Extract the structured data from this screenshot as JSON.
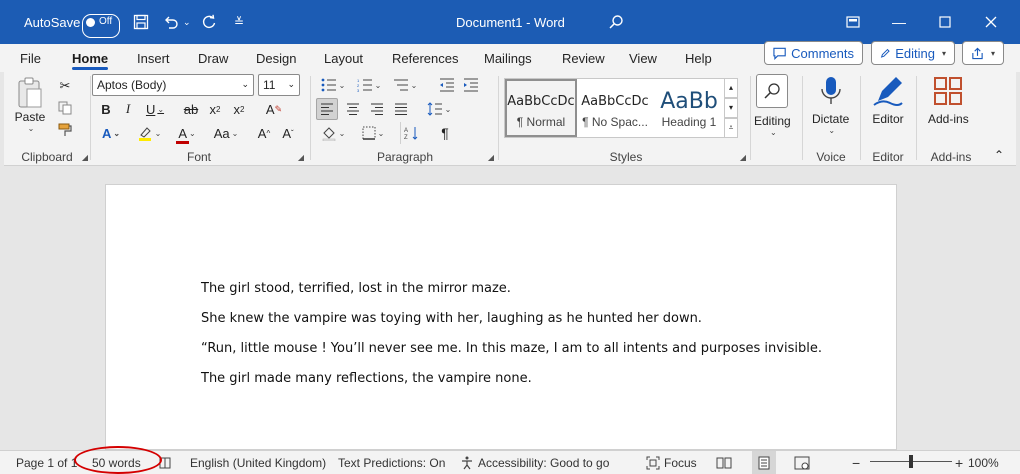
{
  "titlebar": {
    "autosave_label": "AutoSave",
    "autosave_state": "Off",
    "document_title": "Document1  -  Word"
  },
  "tabs": [
    "File",
    "Home",
    "Insert",
    "Draw",
    "Design",
    "Layout",
    "References",
    "Mailings",
    "Review",
    "View",
    "Help"
  ],
  "active_tab": "Home",
  "tab_buttons": {
    "comments": "Comments",
    "editing": "Editing"
  },
  "clipboard": {
    "paste": "Paste",
    "label": "Clipboard"
  },
  "font": {
    "name": "Aptos (Body)",
    "size": "11",
    "label": "Font"
  },
  "paragraph": {
    "label": "Paragraph"
  },
  "styles": {
    "label": "Styles",
    "items": [
      {
        "sample": "AaBbCcDc",
        "name": "¶ Normal"
      },
      {
        "sample": "AaBbCcDc",
        "name": "¶ No Spac..."
      },
      {
        "sample": "AaBb",
        "name": "Heading 1"
      }
    ]
  },
  "editing_group": {
    "label": "Editing"
  },
  "voice": {
    "button": "Dictate",
    "label": "Voice"
  },
  "editor": {
    "button": "Editor",
    "label": "Editor"
  },
  "addins": {
    "button": "Add-ins",
    "label": "Add-ins"
  },
  "document": {
    "paragraphs": [
      "The girl stood, terrified, lost in the mirror maze.",
      "She knew the vampire was toying with her, laughing as he hunted her down.",
      "“Run, little mouse ! You’ll never see me. In this maze, I am to all intents and purposes invisible.",
      "The girl made many reflections, the vampire none."
    ]
  },
  "statusbar": {
    "page": "Page 1 of 1",
    "words": "50 words",
    "language": "English (United Kingdom)",
    "predictions": "Text Predictions: On",
    "accessibility": "Accessibility: Good to go",
    "focus": "Focus",
    "zoom": "100%",
    "zoom_minus": "−",
    "zoom_plus": "+"
  },
  "colors": {
    "titlebar": "#1c5cb4",
    "accent": "#185abd",
    "highlight": "#ffeb00",
    "font_color": "#c00000",
    "annotation": "#d40000"
  }
}
